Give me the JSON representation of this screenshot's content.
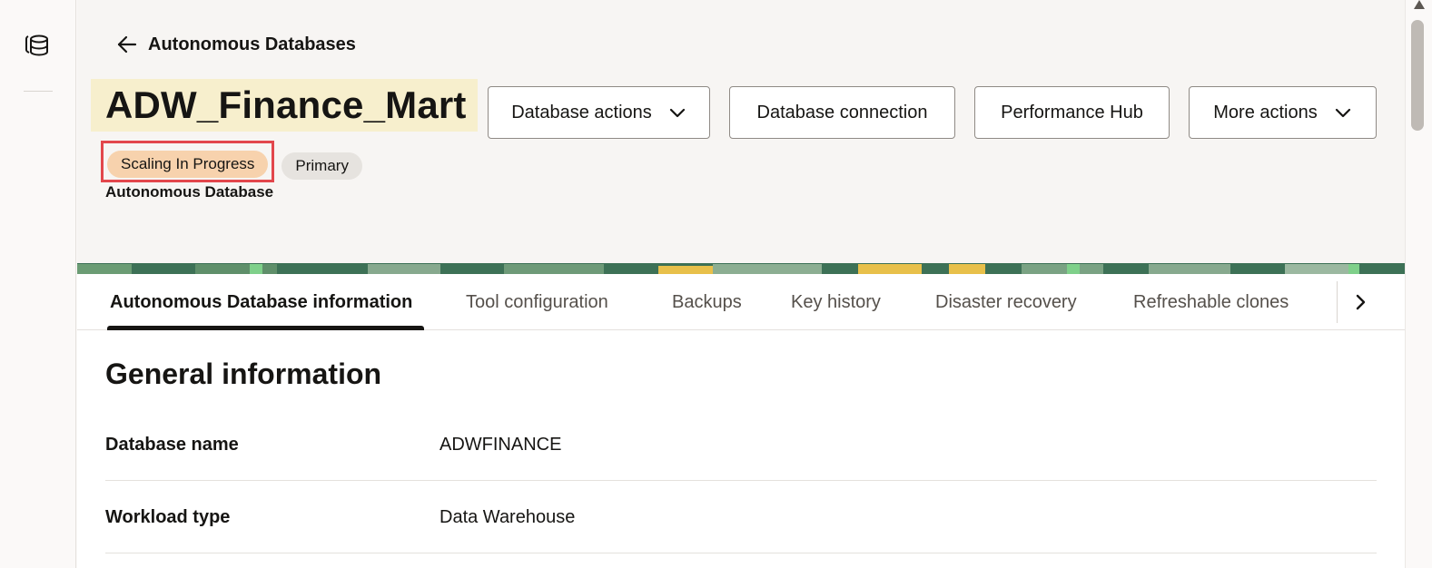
{
  "nav": {
    "back_label": "Autonomous Databases"
  },
  "header": {
    "title": "ADW_Finance_Mart",
    "subtitle": "Autonomous Database",
    "actions": {
      "database_actions": "Database actions",
      "database_connection": "Database connection",
      "performance_hub": "Performance Hub",
      "more_actions": "More actions"
    },
    "badges": {
      "status": "Scaling In Progress",
      "role": "Primary"
    }
  },
  "tabs": [
    {
      "label": "Autonomous Database information",
      "active": true
    },
    {
      "label": "Tool configuration",
      "active": false
    },
    {
      "label": "Backups",
      "active": false
    },
    {
      "label": "Key history",
      "active": false
    },
    {
      "label": "Disaster recovery",
      "active": false
    },
    {
      "label": "Refreshable clones",
      "active": false
    }
  ],
  "general_information": {
    "heading": "General information",
    "rows": [
      {
        "label": "Database name",
        "value": "ADWFINANCE"
      },
      {
        "label": "Workload type",
        "value": "Data Warehouse"
      }
    ]
  },
  "icons": {
    "rail_icon": "database-icon",
    "back": "arrow-left-icon",
    "dropdown": "chevron-down-icon",
    "tabs_next": "chevron-right-icon"
  },
  "colors": {
    "title_highlight": "#f7efcd",
    "status_badge": "#f7d2ad",
    "role_badge": "#e6e3df",
    "annotation_box": "#e2474c"
  }
}
